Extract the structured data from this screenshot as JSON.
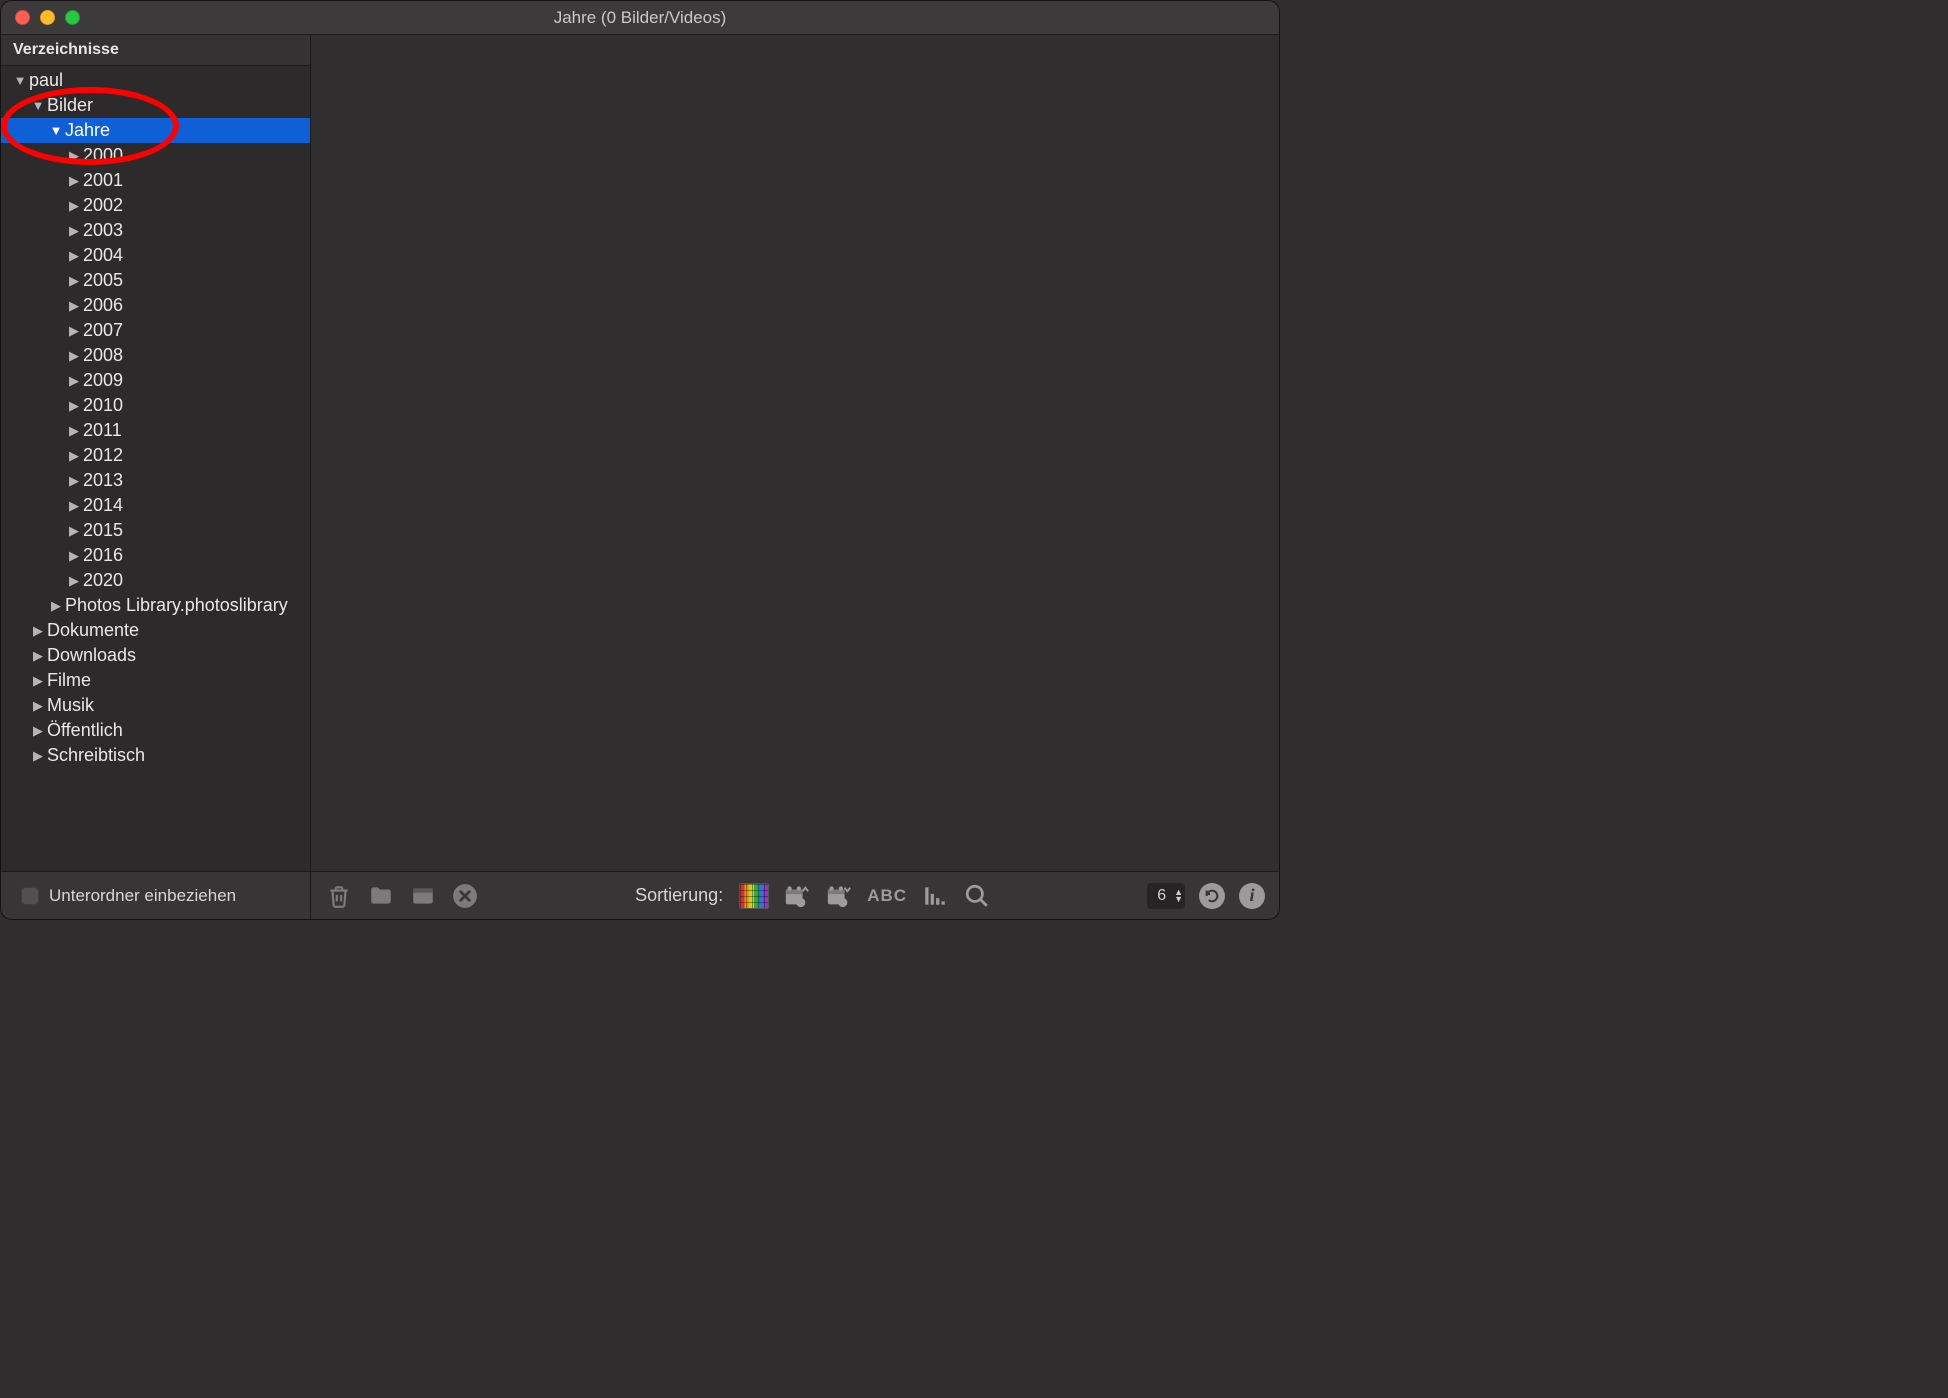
{
  "window": {
    "title": "Jahre (0 Bilder/Videos)"
  },
  "sidebar": {
    "heading": "Verzeichnisse",
    "tree": [
      {
        "label": "paul",
        "level": 0,
        "expanded": true,
        "selected": false
      },
      {
        "label": "Bilder",
        "level": 1,
        "expanded": true,
        "selected": false
      },
      {
        "label": "Jahre",
        "level": 2,
        "expanded": true,
        "selected": true
      },
      {
        "label": "2000",
        "level": 3,
        "expanded": false,
        "selected": false
      },
      {
        "label": "2001",
        "level": 3,
        "expanded": false,
        "selected": false
      },
      {
        "label": "2002",
        "level": 3,
        "expanded": false,
        "selected": false
      },
      {
        "label": "2003",
        "level": 3,
        "expanded": false,
        "selected": false
      },
      {
        "label": "2004",
        "level": 3,
        "expanded": false,
        "selected": false
      },
      {
        "label": "2005",
        "level": 3,
        "expanded": false,
        "selected": false
      },
      {
        "label": "2006",
        "level": 3,
        "expanded": false,
        "selected": false
      },
      {
        "label": "2007",
        "level": 3,
        "expanded": false,
        "selected": false
      },
      {
        "label": "2008",
        "level": 3,
        "expanded": false,
        "selected": false
      },
      {
        "label": "2009",
        "level": 3,
        "expanded": false,
        "selected": false
      },
      {
        "label": "2010",
        "level": 3,
        "expanded": false,
        "selected": false
      },
      {
        "label": "2011",
        "level": 3,
        "expanded": false,
        "selected": false
      },
      {
        "label": "2012",
        "level": 3,
        "expanded": false,
        "selected": false
      },
      {
        "label": "2013",
        "level": 3,
        "expanded": false,
        "selected": false
      },
      {
        "label": "2014",
        "level": 3,
        "expanded": false,
        "selected": false
      },
      {
        "label": "2015",
        "level": 3,
        "expanded": false,
        "selected": false
      },
      {
        "label": "2016",
        "level": 3,
        "expanded": false,
        "selected": false
      },
      {
        "label": "2020",
        "level": 3,
        "expanded": false,
        "selected": false
      },
      {
        "label": "Photos Library.photoslibrary",
        "level": 2,
        "expanded": false,
        "selected": false
      },
      {
        "label": "Dokumente",
        "level": 1,
        "expanded": false,
        "selected": false
      },
      {
        "label": "Downloads",
        "level": 1,
        "expanded": false,
        "selected": false
      },
      {
        "label": "Filme",
        "level": 1,
        "expanded": false,
        "selected": false
      },
      {
        "label": "Musik",
        "level": 1,
        "expanded": false,
        "selected": false
      },
      {
        "label": "Öffentlich",
        "level": 1,
        "expanded": false,
        "selected": false
      },
      {
        "label": "Schreibtisch",
        "level": 1,
        "expanded": false,
        "selected": false
      }
    ]
  },
  "footer": {
    "include_subfolders_label": "Unterordner einbeziehen",
    "sort_label": "Sortierung:",
    "abc_label": "ABC",
    "stepper_value": "6"
  },
  "annotation": {
    "ellipse_area": "Bilder / Jahre folders circled in red"
  }
}
